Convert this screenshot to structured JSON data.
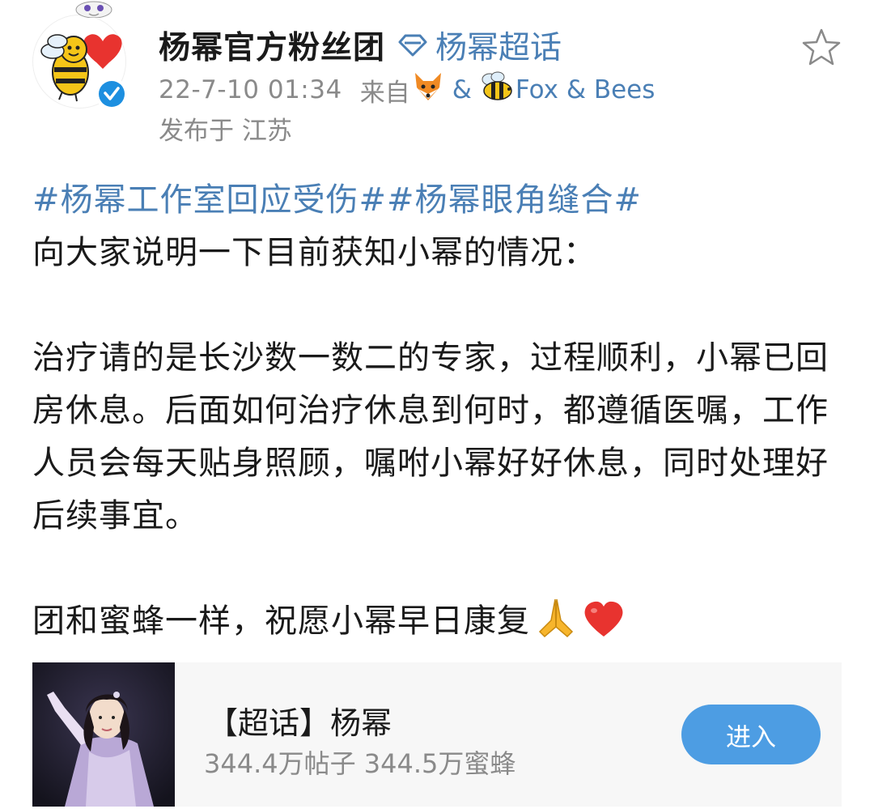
{
  "header": {
    "account_name": "杨幂官方粉丝团",
    "super_topic_link": "杨幂超话",
    "timestamp": "22-7-10 01:34",
    "from_label": "来自",
    "source_separator": "&",
    "source_name": "Fox & Bees",
    "location": "发布于 江苏"
  },
  "post": {
    "topics": "#杨幂工作室回应受伤##杨幂眼角缝合#",
    "line1": "向大家说明一下目前获知小幂的情况：",
    "paragraph2": "治疗请的是长沙数一数二的专家，过程顺利，小幂已回房休息。后面如何治疗休息到何时，都遵循医嘱，工作人员会每天贴身照顾，嘱咐小幂好好休息，同时处理好后续事宜。",
    "paragraph3": "团和蜜蜂一样，祝愿小幂早日康复"
  },
  "card": {
    "title": "【超话】杨幂",
    "stats": "344.4万帖子 344.5万蜜蜂",
    "button_label": "进入"
  },
  "icons": {
    "avatar": "bee-heart-avatar",
    "verified": "verified-badge-icon",
    "diamond": "diamond-icon",
    "fox": "fox-emoji",
    "bee": "bee-emoji",
    "star": "star-icon",
    "pray": "praying-hands-emoji",
    "heart": "red-heart-emoji"
  },
  "colors": {
    "link": "#4a7fb5",
    "meta": "#8a8a8a",
    "button": "#4d9de3",
    "card_bg": "#f7f7f7",
    "verified": "#1d8fe0"
  }
}
